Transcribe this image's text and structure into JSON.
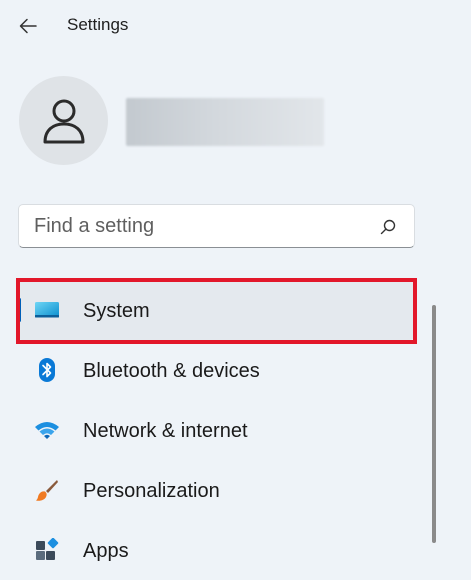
{
  "titlebar": {
    "back_icon": "back-arrow-icon",
    "title": "Settings"
  },
  "profile": {
    "avatar_icon": "person-icon",
    "name_redacted": true
  },
  "search": {
    "placeholder": "Find a setting",
    "value": "",
    "icon": "search-icon"
  },
  "nav": {
    "items": [
      {
        "label": "System",
        "icon": "monitor-icon",
        "selected": true
      },
      {
        "label": "Bluetooth & devices",
        "icon": "bluetooth-icon",
        "selected": false
      },
      {
        "label": "Network & internet",
        "icon": "wifi-icon",
        "selected": false
      },
      {
        "label": "Personalization",
        "icon": "brush-icon",
        "selected": false
      },
      {
        "label": "Apps",
        "icon": "apps-icon",
        "selected": false
      }
    ]
  },
  "colors": {
    "background": "#eef3f8",
    "accent": "#005fb8",
    "highlight_box": "#e2172a",
    "selected_bg": "#e4e9ee"
  }
}
